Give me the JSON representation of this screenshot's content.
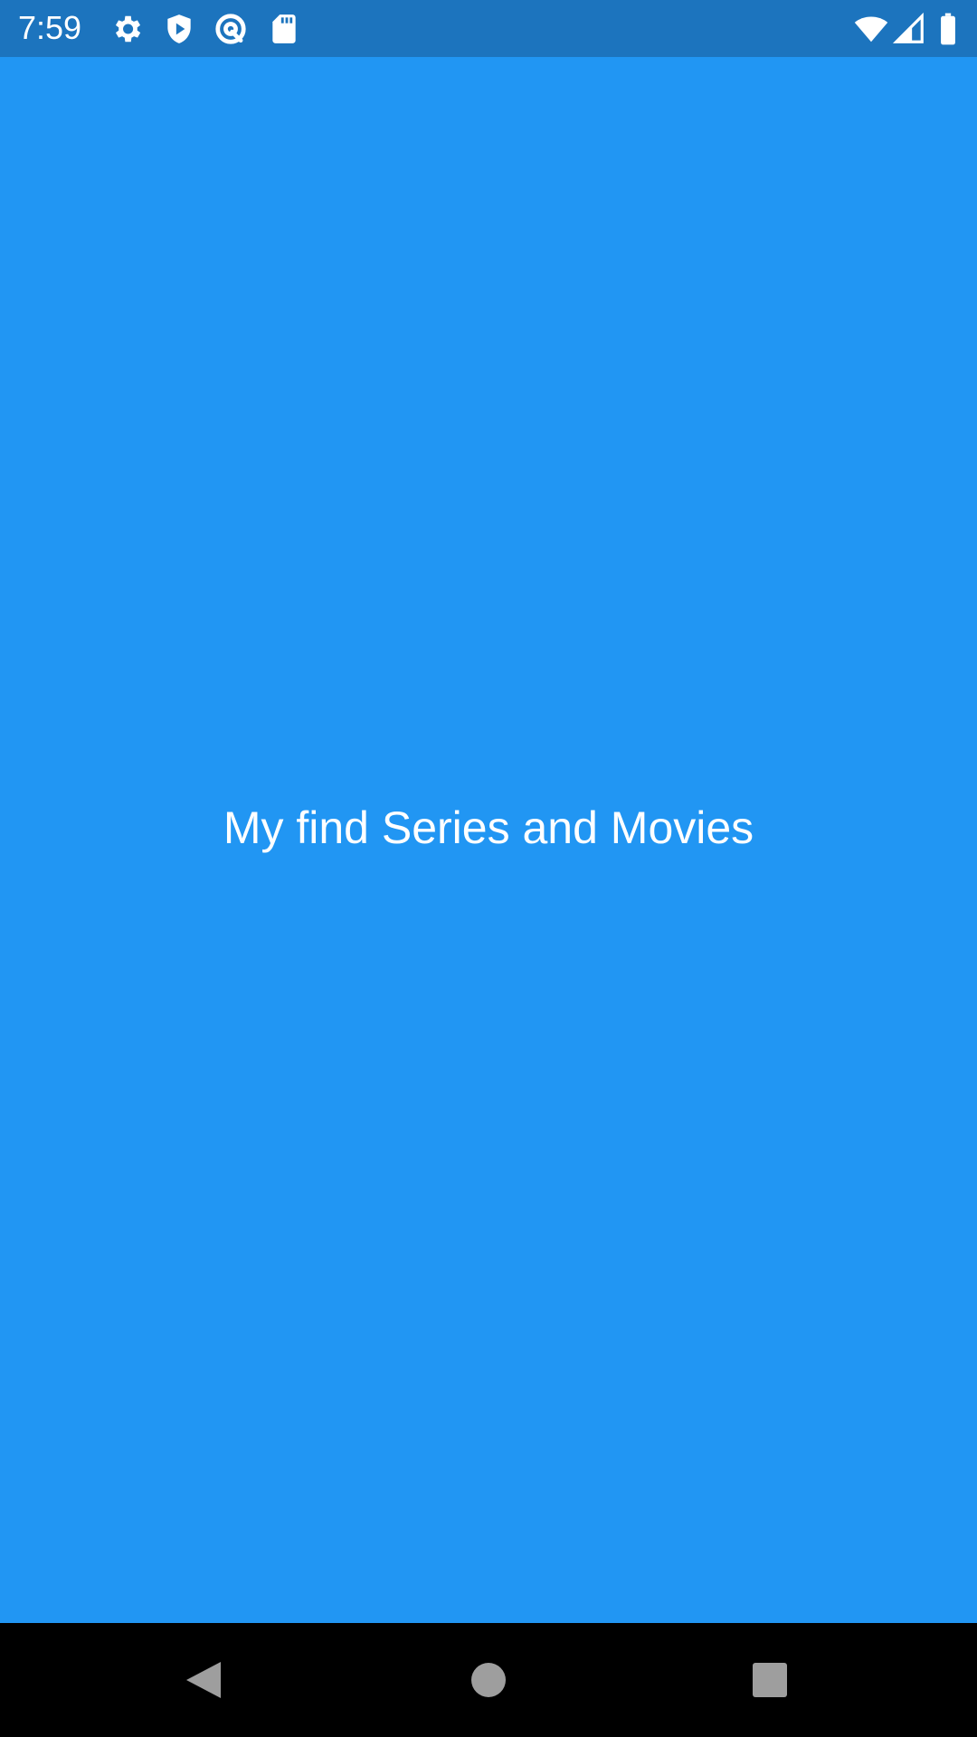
{
  "status_bar": {
    "time": "7:59",
    "left_icons": [
      "gear-icon",
      "shield-play-icon",
      "at-sign-icon",
      "sd-card-icon"
    ],
    "right_icons": [
      "wifi-icon",
      "signal-icon",
      "battery-icon"
    ]
  },
  "splash": {
    "title": "My find Series and Movies",
    "background_color": "#2196F3",
    "text_color": "#FFFFFF"
  },
  "nav_bar": {
    "buttons": [
      "back-icon",
      "home-icon",
      "recents-icon"
    ]
  }
}
